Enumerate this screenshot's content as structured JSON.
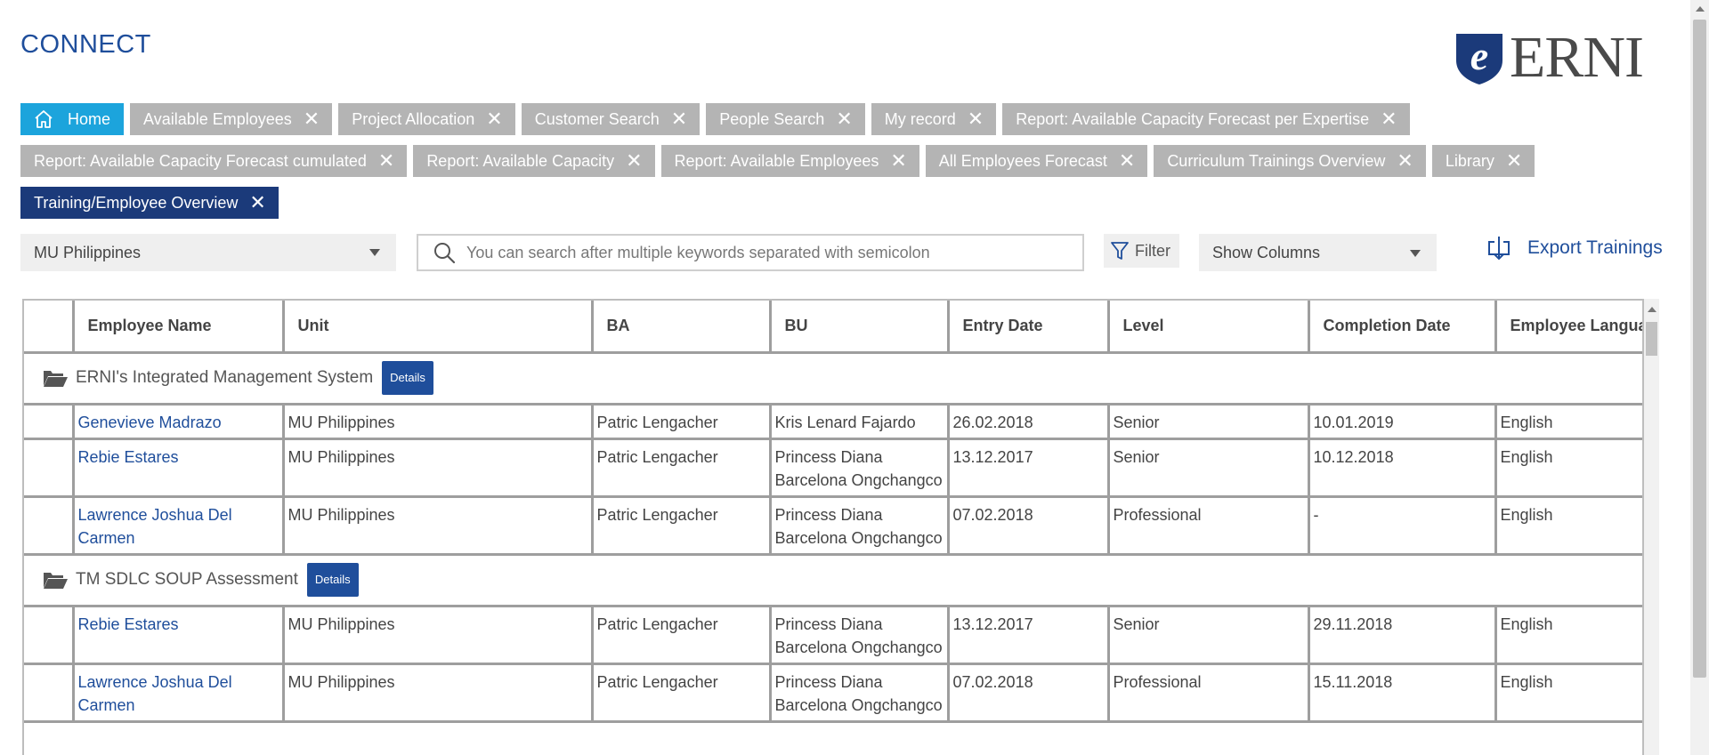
{
  "app": {
    "brand": "CONNECT",
    "logo_text": "ERNI",
    "logo_mark": "e"
  },
  "tabs": [
    [
      {
        "label": "Home",
        "type": "home",
        "closable": false
      },
      {
        "label": "Available Employees",
        "type": "normal",
        "closable": true
      },
      {
        "label": "Project Allocation",
        "type": "normal",
        "closable": true
      },
      {
        "label": "Customer Search",
        "type": "normal",
        "closable": true
      },
      {
        "label": "People Search",
        "type": "normal",
        "closable": true
      },
      {
        "label": "My record",
        "type": "normal",
        "closable": true
      },
      {
        "label": "Report: Available Capacity Forecast per Expertise",
        "type": "normal",
        "closable": true
      }
    ],
    [
      {
        "label": "Report: Available Capacity Forecast cumulated",
        "type": "normal",
        "closable": true
      },
      {
        "label": "Report: Available Capacity",
        "type": "normal",
        "closable": true
      },
      {
        "label": "Report: Available Employees",
        "type": "normal",
        "closable": true
      },
      {
        "label": "All Employees Forecast",
        "type": "normal",
        "closable": true
      },
      {
        "label": "Curriculum Trainings Overview",
        "type": "normal",
        "closable": true
      },
      {
        "label": "Library",
        "type": "normal",
        "closable": true
      }
    ],
    [
      {
        "label": "Training/Employee Overview",
        "type": "active",
        "closable": true
      }
    ]
  ],
  "tab_close_glyph": "✕",
  "toolbar": {
    "unit_select_value": "MU Philippines",
    "search_placeholder": "You can search after multiple keywords separated with semicolon",
    "filter_label": "Filter",
    "columns_select_value": "Show Columns",
    "export_label": "Export Trainings"
  },
  "table": {
    "headers": [
      "",
      "Employee Name",
      "Unit",
      "BA",
      "BU",
      "Entry Date",
      "Level",
      "Completion Date",
      "Employee Langua"
    ],
    "groups": [
      {
        "title": "ERNI's Integrated Management System",
        "details_label": "Details",
        "rows": [
          [
            "",
            "Genevieve Madrazo",
            "MU Philippines",
            "Patric Lengacher",
            "Kris Lenard Fajardo",
            "26.02.2018",
            "Senior",
            "10.01.2019",
            "English"
          ],
          [
            "",
            "Rebie Estares",
            "MU Philippines",
            "Patric Lengacher",
            "Princess Diana Barcelona Ongchangco",
            "13.12.2017",
            "Senior",
            "10.12.2018",
            "English"
          ],
          [
            "",
            "Lawrence Joshua Del Carmen",
            "MU Philippines",
            "Patric Lengacher",
            "Princess Diana Barcelona Ongchangco",
            "07.02.2018",
            "Professional",
            "-",
            "English"
          ]
        ]
      },
      {
        "title": "TM SDLC SOUP Assessment",
        "details_label": "Details",
        "rows": [
          [
            "",
            "Rebie Estares",
            "MU Philippines",
            "Patric Lengacher",
            "Princess Diana Barcelona Ongchangco",
            "13.12.2017",
            "Senior",
            "29.11.2018",
            "English"
          ],
          [
            "",
            "Lawrence Joshua Del Carmen",
            "MU Philippines",
            "Patric Lengacher",
            "Princess Diana Barcelona Ongchangco",
            "07.02.2018",
            "Professional",
            "15.11.2018",
            "English"
          ]
        ]
      }
    ]
  },
  "colors": {
    "brand_blue": "#1f4e9b",
    "home_tab": "#1ca4dc",
    "active_tab": "#1b3a7a",
    "inactive_tab": "#b4b4b4"
  }
}
